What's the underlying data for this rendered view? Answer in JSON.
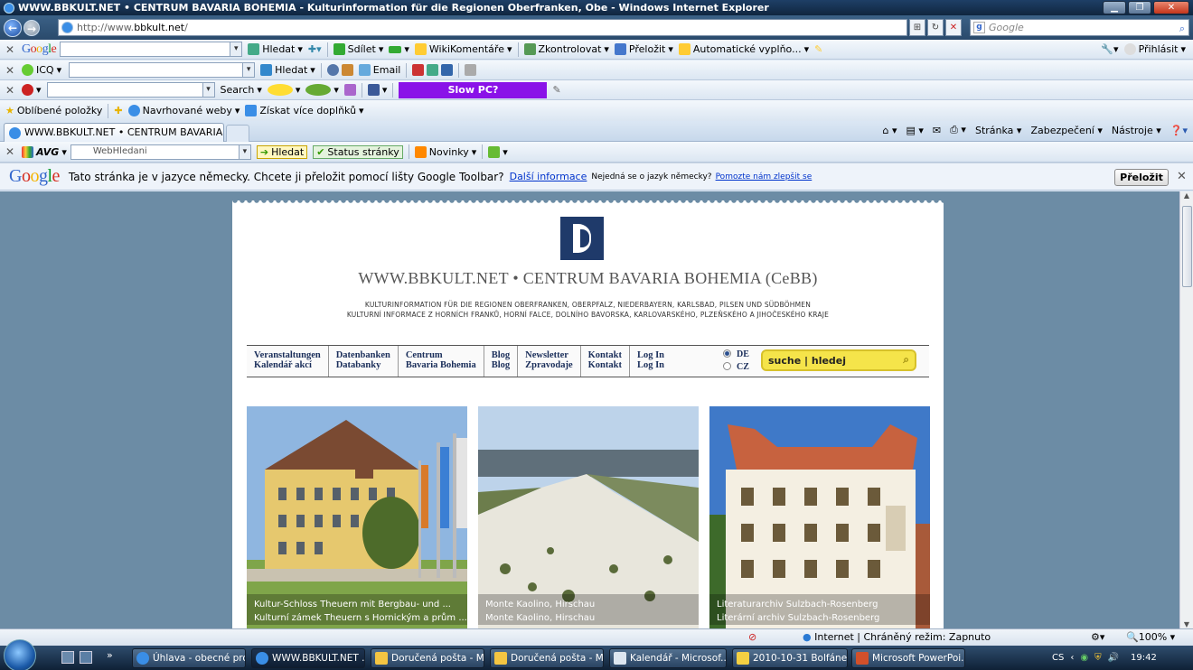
{
  "window": {
    "title": "WWW.BBKULT.NET • CENTRUM BAVARIA BOHEMIA - Kulturinformation für die Regionen Oberfranken, Obe - Windows Internet Explorer"
  },
  "address": {
    "prefix": "http://www.",
    "domain": "bbkult.net",
    "suffix": "/",
    "search_placeholder": "Google"
  },
  "google_toolbar": {
    "logo": "Google",
    "search": "Hledat",
    "share": "Sdílet",
    "wiki": "WikiKomentáře",
    "check": "Zkontrolovat",
    "translate": "Přeložit",
    "autofill": "Automatické vyplňo...",
    "signin": "Přihlásit"
  },
  "icq_toolbar": {
    "logo": "ICQ",
    "search": "Hledat",
    "email": "Email"
  },
  "third_toolbar": {
    "search": "Search",
    "slowpc": "Slow PC?"
  },
  "favorites": {
    "fav": "Oblíbené položky",
    "suggested": "Navrhované weby",
    "addons": "Získat více doplňků"
  },
  "tab": {
    "title": "WWW.BBKULT.NET • CENTRUM BAVARIA BOHE..."
  },
  "commandbar": {
    "page": "Stránka",
    "security": "Zabezpečení",
    "tools": "Nástroje"
  },
  "avg": {
    "label": "AVG",
    "search_placeholder": "WebHledani",
    "search": "Hledat",
    "status": "Status stránky",
    "news": "Novinky"
  },
  "translate_bar": {
    "message": "Tato stránka je v jazyce německy. Chcete ji přeložit pomocí lišty Google Toolbar?",
    "more": "Další informace",
    "not_german": "Nejedná se o jazyk německy?",
    "help": "Pomozte nám zlepšit se",
    "button": "Přeložit"
  },
  "site": {
    "title": "WWW.BBKULT.NET • CENTRUM BAVARIA BOHEMIA (CeBB)",
    "sub_de": "KULTURINFORMATION FÜR DIE REGIONEN OBERFRANKEN, OBERPFALZ, NIEDERBAYERN, KARLSBAD, PILSEN UND SÜDBÖHMEN",
    "sub_cz": "KULTURNÍ INFORMACE Z HORNÍCH FRANKŮ, HORNÍ FALCE, DOLNÍHO BAVORSKA, KARLOVARSKÉHO, PLZEŇSKÉHO A JIHOČESKÉHO KRAJE",
    "nav": [
      {
        "de": "Veranstaltungen",
        "cz": "Kalendář akcí"
      },
      {
        "de": "Datenbanken",
        "cz": "Databanky"
      },
      {
        "de": "Centrum",
        "cz": "Bavaria Bohemia"
      },
      {
        "de": "Blog",
        "cz": "Blog"
      },
      {
        "de": "Newsletter",
        "cz": "Zpravodaje"
      },
      {
        "de": "Kontakt",
        "cz": "Kontakt"
      },
      {
        "de": "Log In",
        "cz": "Log In"
      }
    ],
    "lang": [
      "DE",
      "CZ"
    ],
    "search": "suche | hledej",
    "images": [
      {
        "line1": "Kultur-Schloss Theuern mit Bergbau- und ...",
        "line2": "Kulturní zámek Theuern s Hornickým a prům ..."
      },
      {
        "line1": "Monte Kaolino, Hirschau",
        "line2": "Monte Kaolino, Hirschau"
      },
      {
        "line1": "Literaturarchiv Sulzbach-Rosenberg",
        "line2": "Literární archiv Sulzbach-Rosenberg"
      }
    ]
  },
  "status": {
    "zone": "Internet | Chráněný režim: Zapnuto",
    "zoom": "100%"
  },
  "taskbar": {
    "buttons": [
      "Úhlava - obecné pro...",
      "WWW.BBKULT.NET ...",
      "Doručená pošta - M...",
      "Doručená pošta - M...",
      "Kalendář - Microsof...",
      "2010-10-31 Bolfánek",
      "Microsoft PowerPoi..."
    ],
    "lang": "CS",
    "time": "19:42"
  }
}
